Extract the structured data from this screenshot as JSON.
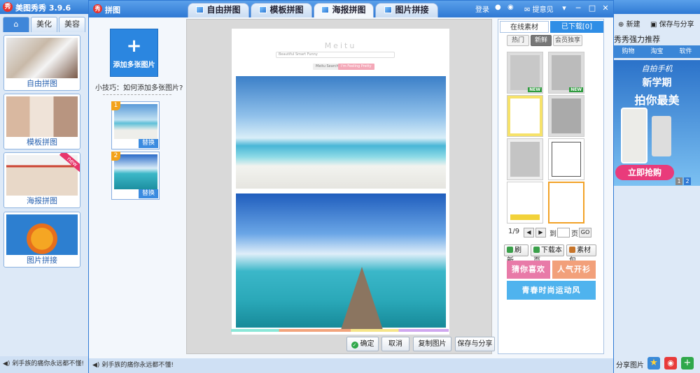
{
  "main_app": {
    "title": "美图秀秀 3.9.6",
    "logo": "秀"
  },
  "left_panel": {
    "tabs": [
      "美化",
      "美容"
    ],
    "features": [
      "自由拼图",
      "模板拼图",
      "海报拼图",
      "图片拼接"
    ],
    "badge": "new",
    "status": "剁手族的痛你永远都不懂!"
  },
  "dialog": {
    "title": "拼图",
    "logo": "秀",
    "tabs": [
      "自由拼图",
      "模板拼图",
      "海报拼图",
      "图片拼接"
    ],
    "login": "登录",
    "feedback": "提意见",
    "add_button": "添加多张图片",
    "tip": "小技巧：如何添加多张图片?",
    "slots": [
      {
        "num": "1",
        "replace": "替换"
      },
      {
        "num": "2",
        "replace": "替换"
      }
    ],
    "actions": {
      "confirm": "确定",
      "cancel": "取消",
      "copy": "复制图片",
      "save": "保存与分享"
    },
    "status": "剁手族的痛你永远都不懂!"
  },
  "poster": {
    "title": "Meitu",
    "search_text": "Beautiful Smart Funny",
    "button1": "Meitu Search",
    "button2": "I'm Feeling Pretty"
  },
  "materials": {
    "tabs": [
      "在线素材",
      "已下载[0]"
    ],
    "subtabs": [
      "热门",
      "新鲜",
      "会员独享"
    ],
    "new_badge": "NEW",
    "pager": {
      "page": "1/9",
      "goto": "到",
      "unit": "页",
      "go": "GO"
    },
    "tools": [
      "刷新",
      "下载本页",
      "素材包"
    ],
    "banners": [
      "猜你喜欢",
      "人气开衫",
      "青春时尚运动风"
    ]
  },
  "far_right": {
    "new": "新建",
    "save": "保存与分享",
    "recommend": "秀秀强力推荐",
    "ad_tabs": [
      "购物",
      "淘宝",
      "软件"
    ],
    "ad_line1": "新学期",
    "ad_line2": "拍你最美",
    "ad_buy": "立即抢购",
    "ad_brand": "自拍手机",
    "pages": [
      "1",
      "2"
    ],
    "share": "分享图片"
  },
  "colors": {
    "accent": "#2f79d4",
    "add": "#2b86e0",
    "banner_pink": "#e87aa8",
    "banner_orange": "#f2a07a",
    "banner_blue": "#4fb3ee"
  }
}
